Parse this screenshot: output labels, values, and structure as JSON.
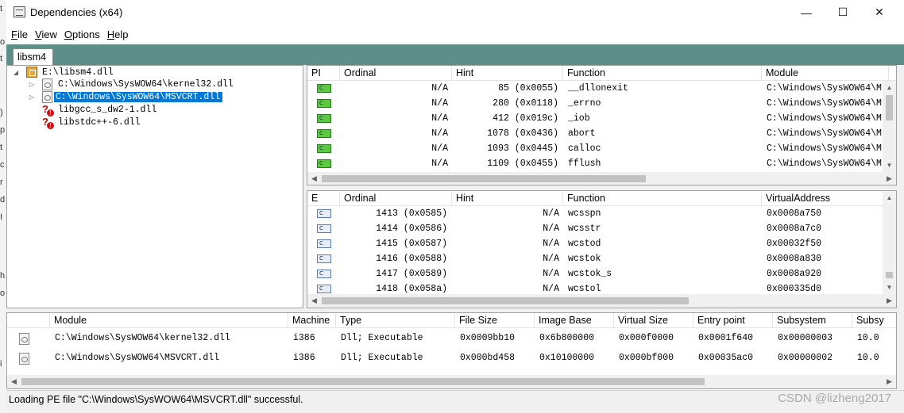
{
  "window": {
    "title": "Dependencies (x64)",
    "minimize": "—",
    "maximize": "☐",
    "close": "✕"
  },
  "menu": [
    {
      "u": "F",
      "rest": "ile"
    },
    {
      "u": "V",
      "rest": "iew"
    },
    {
      "u": "O",
      "rest": "ptions"
    },
    {
      "u": "H",
      "rest": "elp"
    }
  ],
  "tab": {
    "label": "libsm4"
  },
  "tree": {
    "root": "E:\\libsm4.dll",
    "children": [
      {
        "label": "C:\\Windows\\SysWOW64\\kernel32.dll",
        "type": "file",
        "selected": false
      },
      {
        "label": "C:\\Windows\\SysWOW64\\MSVCRT.dll",
        "type": "file",
        "selected": true
      },
      {
        "label": "libgcc_s_dw2-1.dll",
        "type": "missing",
        "selected": false
      },
      {
        "label": "libstdc++-6.dll",
        "type": "missing",
        "selected": false
      }
    ]
  },
  "imports": {
    "headers": [
      "PI",
      "Ordinal",
      "Hint",
      "Function",
      "Module"
    ],
    "rows": [
      {
        "ordinal": "N/A",
        "hint": "85 (0x0055)",
        "function": "__dllonexit",
        "module": "C:\\Windows\\SysWOW64\\M"
      },
      {
        "ordinal": "N/A",
        "hint": "280 (0x0118)",
        "function": "_errno",
        "module": "C:\\Windows\\SysWOW64\\M"
      },
      {
        "ordinal": "N/A",
        "hint": "412 (0x019c)",
        "function": "_iob",
        "module": "C:\\Windows\\SysWOW64\\M"
      },
      {
        "ordinal": "N/A",
        "hint": "1078 (0x0436)",
        "function": "abort",
        "module": "C:\\Windows\\SysWOW64\\M"
      },
      {
        "ordinal": "N/A",
        "hint": "1093 (0x0445)",
        "function": "calloc",
        "module": "C:\\Windows\\SysWOW64\\M"
      },
      {
        "ordinal": "N/A",
        "hint": "1109 (0x0455)",
        "function": "fflush",
        "module": "C:\\Windows\\SysWOW64\\M"
      }
    ]
  },
  "exports": {
    "headers": [
      "E",
      "Ordinal",
      "Hint",
      "Function",
      "VirtualAddress"
    ],
    "rows": [
      {
        "ordinal": "1413 (0x0585)",
        "hint": "N/A",
        "function": "wcsspn",
        "va": "0x0008a750"
      },
      {
        "ordinal": "1414 (0x0586)",
        "hint": "N/A",
        "function": "wcsstr",
        "va": "0x0008a7c0"
      },
      {
        "ordinal": "1415 (0x0587)",
        "hint": "N/A",
        "function": "wcstod",
        "va": "0x00032f50"
      },
      {
        "ordinal": "1416 (0x0588)",
        "hint": "N/A",
        "function": "wcstok",
        "va": "0x0008a830"
      },
      {
        "ordinal": "1417 (0x0589)",
        "hint": "N/A",
        "function": "wcstok_s",
        "va": "0x0008a920"
      },
      {
        "ordinal": "1418 (0x058a)",
        "hint": "N/A",
        "function": "wcstol",
        "va": "0x000335d0"
      }
    ]
  },
  "modules": {
    "headers": [
      "Module",
      "Machine",
      "Type",
      "File Size",
      "Image Base",
      "Virtual Size",
      "Entry point",
      "Subsystem",
      "Subsy"
    ],
    "rows": [
      {
        "module": "C:\\Windows\\SysWOW64\\kernel32.dll",
        "machine": "i386",
        "type": "Dll; Executable",
        "size": "0x0009bb10",
        "base": "0x6b800000",
        "vsize": "0x000f0000",
        "entry": "0x0001f640",
        "subsystem": "0x00000003",
        "subver": "10.0"
      },
      {
        "module": "C:\\Windows\\SysWOW64\\MSVCRT.dll",
        "machine": "i386",
        "type": "Dll; Executable",
        "size": "0x000bd458",
        "base": "0x10100000",
        "vsize": "0x000bf000",
        "entry": "0x00035ac0",
        "subsystem": "0x00000002",
        "subver": "10.0"
      }
    ]
  },
  "status": {
    "text": "Loading PE file \"C:\\Windows\\SysWOW64\\MSVCRT.dll\" successful."
  },
  "watermark": "CSDN @lizheng2017",
  "colors": {
    "accent_band": "#5c8f87",
    "selection": "#0078d7",
    "import_icon": "#5ac840"
  },
  "icons": {
    "app": "dependencies-app-icon",
    "tree_root": "dll-folder-icon",
    "tree_file": "dll-file-icon",
    "tree_missing": "missing-dll-icon",
    "import_func": "c-function-import-icon",
    "export_func": "c-function-export-icon",
    "module": "module-file-icon"
  },
  "background_chars": [
    "t",
    "o",
    "t",
    ")",
    "p",
    "t",
    "c",
    "r",
    "d",
    "I",
    "h",
    "o",
    "i"
  ]
}
